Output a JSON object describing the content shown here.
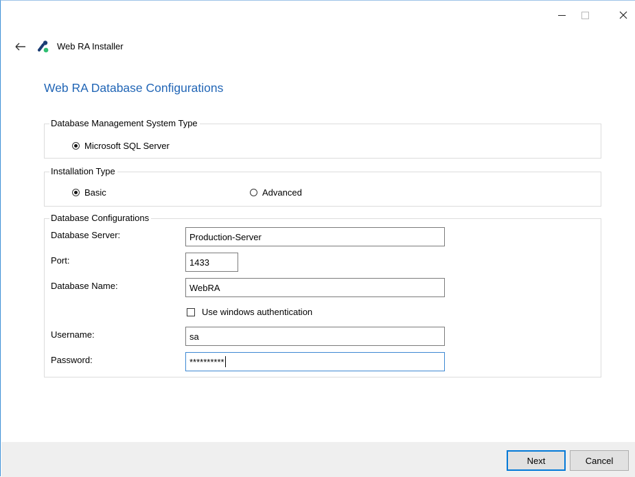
{
  "window": {
    "app_title": "Web RA Installer",
    "page_title": "Web RA Database Configurations",
    "accent_color": "#2266b6"
  },
  "dbms_group": {
    "legend": "Database Management System Type",
    "options": [
      {
        "label": "Microsoft SQL Server",
        "selected": true
      }
    ]
  },
  "install_group": {
    "legend": "Installation Type",
    "options": [
      {
        "label": "Basic",
        "selected": true
      },
      {
        "label": "Advanced",
        "selected": false
      }
    ]
  },
  "db_group": {
    "legend": "Database Configurations",
    "server_label": "Database Server:",
    "server_value": "Production-Server",
    "port_label": "Port:",
    "port_value": "1433",
    "dbname_label": "Database Name:",
    "dbname_value": "WebRA",
    "winauth_label": "Use windows authentication",
    "winauth_checked": false,
    "username_label": "Username:",
    "username_value": "sa",
    "password_label": "Password:",
    "password_value": "**********"
  },
  "footer": {
    "next_label": "Next",
    "cancel_label": "Cancel"
  }
}
